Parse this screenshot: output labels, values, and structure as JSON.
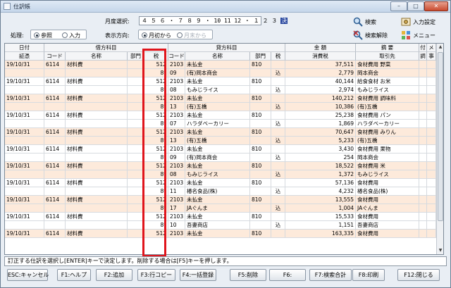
{
  "window": {
    "title": "仕訳帳"
  },
  "toolbar": {
    "month_label": "月度選択:",
    "month_text": "４ ５ ６ ・ ７ ８ ９ ・ 10 11 12 ・ １ ２ ３",
    "month_selected": "決",
    "mode_label": "処理:",
    "mode_options": [
      "参照",
      "入力"
    ],
    "direction_label": "表示方向:",
    "direction_options": [
      "月初から",
      "月末から"
    ],
    "search_label": "検索",
    "search_clear_label": "検索解除",
    "input_settings_label": "入力設定",
    "menu_label": "メニュー"
  },
  "table": {
    "header_top": {
      "date": "日付",
      "debit": "借方科目",
      "credit": "貸方科目",
      "amount": "金 額",
      "summary": "摘 要",
      "attach": "付",
      "memo": "メ"
    },
    "header_bottom": {
      "voucher": "証憑",
      "code": "コード",
      "name": "名称",
      "dept": "部門",
      "tax": "税",
      "code2": "コード",
      "name2": "名称",
      "dept2": "部門",
      "tax2": "税",
      "consumption_tax": "消費税",
      "partner": "取引先",
      "attach2": "調",
      "memo2": "事 成"
    },
    "rows": [
      {
        "date": "19/10/31",
        "code": "6114",
        "name": "材料費",
        "tax": "512",
        "ccode": "2103",
        "cname": "未払金",
        "cdept": "810",
        "ctax": "",
        "amount": "37,511",
        "summary": "食材費用 野菜"
      },
      {
        "date": "",
        "code": "",
        "name": "",
        "tax": "8*",
        "ccode": "09",
        "cname": "(有)岡本商会",
        "cdept": "",
        "ctax": "込",
        "amount": "2,779",
        "summary": "岡本商会"
      },
      {
        "date": "19/10/31",
        "code": "6114",
        "name": "材料費",
        "tax": "512",
        "ccode": "2103",
        "cname": "未払金",
        "cdept": "810",
        "ctax": "",
        "amount": "40,144",
        "summary": "給食食材 お米"
      },
      {
        "date": "",
        "code": "",
        "name": "",
        "tax": "8*",
        "ccode": "08",
        "cname": "もみじライス",
        "cdept": "",
        "ctax": "込",
        "amount": "2,974",
        "summary": "もみじライス"
      },
      {
        "date": "19/10/31",
        "code": "6114",
        "name": "材料費",
        "tax": "512",
        "ccode": "2103",
        "cname": "未払金",
        "cdept": "810",
        "ctax": "",
        "amount": "140,212",
        "summary": "食材費用 調味料"
      },
      {
        "date": "",
        "code": "",
        "name": "",
        "tax": "8*",
        "ccode": "13",
        "cname": "(有)五橋",
        "cdept": "",
        "ctax": "込",
        "amount": "10,386",
        "summary": "(有)五橋"
      },
      {
        "date": "19/10/31",
        "code": "6114",
        "name": "材料費",
        "tax": "512",
        "ccode": "2103",
        "cname": "未払金",
        "cdept": "810",
        "ctax": "",
        "amount": "25,238",
        "summary": "食材費用 パン"
      },
      {
        "date": "",
        "code": "",
        "name": "",
        "tax": "8*",
        "ccode": "07",
        "cname": "ハラダベーカリー",
        "cdept": "",
        "ctax": "込",
        "amount": "1,869",
        "summary": "ハラダベーカリー"
      },
      {
        "date": "19/10/31",
        "code": "6114",
        "name": "材料費",
        "tax": "512",
        "ccode": "2103",
        "cname": "未払金",
        "cdept": "810",
        "ctax": "",
        "amount": "70,647",
        "summary": "食材費用 みりん"
      },
      {
        "date": "",
        "code": "",
        "name": "",
        "tax": "8*",
        "ccode": "13",
        "cname": "(有)五橋",
        "cdept": "",
        "ctax": "込",
        "amount": "5,233",
        "summary": "(有)五橋"
      },
      {
        "date": "19/10/31",
        "code": "6114",
        "name": "材料費",
        "tax": "512",
        "ccode": "2103",
        "cname": "未払金",
        "cdept": "810",
        "ctax": "",
        "amount": "3,430",
        "summary": "食材費用 果物"
      },
      {
        "date": "",
        "code": "",
        "name": "",
        "tax": "8*",
        "ccode": "09",
        "cname": "(有)岡本商会",
        "cdept": "",
        "ctax": "込",
        "amount": "254",
        "summary": "岡本商会"
      },
      {
        "date": "19/10/31",
        "code": "6114",
        "name": "材料費",
        "tax": "512",
        "ccode": "2103",
        "cname": "未払金",
        "cdept": "810",
        "ctax": "",
        "amount": "18,522",
        "summary": "食材費用 米"
      },
      {
        "date": "",
        "code": "",
        "name": "",
        "tax": "8*",
        "ccode": "08",
        "cname": "もみじライス",
        "cdept": "",
        "ctax": "込",
        "amount": "1,372",
        "summary": "もみじライス"
      },
      {
        "date": "19/10/31",
        "code": "6114",
        "name": "材料費",
        "tax": "512",
        "ccode": "2103",
        "cname": "未払金",
        "cdept": "810",
        "ctax": "",
        "amount": "57,136",
        "summary": "食材費用"
      },
      {
        "date": "",
        "code": "",
        "name": "",
        "tax": "8*",
        "ccode": "11",
        "cname": "椿名食品(株)",
        "cdept": "",
        "ctax": "込",
        "amount": "4,232",
        "summary": "椿名食品(株)"
      },
      {
        "date": "19/10/31",
        "code": "6114",
        "name": "材料費",
        "tax": "512",
        "ccode": "2103",
        "cname": "未払金",
        "cdept": "810",
        "ctax": "",
        "amount": "13,555",
        "summary": "食材費用"
      },
      {
        "date": "",
        "code": "",
        "name": "",
        "tax": "8*",
        "ccode": "17",
        "cname": "JAぐんま",
        "cdept": "",
        "ctax": "込",
        "amount": "1,004",
        "summary": "JAぐんま"
      },
      {
        "date": "19/10/31",
        "code": "6114",
        "name": "材料費",
        "tax": "512",
        "ccode": "2103",
        "cname": "未払金",
        "cdept": "810",
        "ctax": "",
        "amount": "15,533",
        "summary": "食材費用"
      },
      {
        "date": "",
        "code": "",
        "name": "",
        "tax": "8*",
        "ccode": "10",
        "cname": "吾妻商店",
        "cdept": "",
        "ctax": "込",
        "amount": "1,151",
        "summary": "吾妻商店"
      },
      {
        "date": "19/10/31",
        "code": "6114",
        "name": "材料費",
        "tax": "512",
        "ccode": "2103",
        "cname": "未払金",
        "cdept": "810",
        "ctax": "",
        "amount": "163,335",
        "summary": "食材費用"
      }
    ]
  },
  "status_text": "訂正する仕訳を選択し[ENTER]キーで決定します。削除する場合は[F5]キーを押します。",
  "fkeys": [
    "ESC:キャンセル",
    "F1:ヘルプ",
    "F2:追加",
    "F3:行コピー",
    "F4:一括登録",
    "F5:削除",
    "F6:",
    "F7:検索合計",
    "F8:印刷",
    "F12:閉じる"
  ],
  "colors": {
    "pink_row": "#fdeadb",
    "highlight_box": "#e0151c",
    "selected_month": "#1f3f9a"
  }
}
